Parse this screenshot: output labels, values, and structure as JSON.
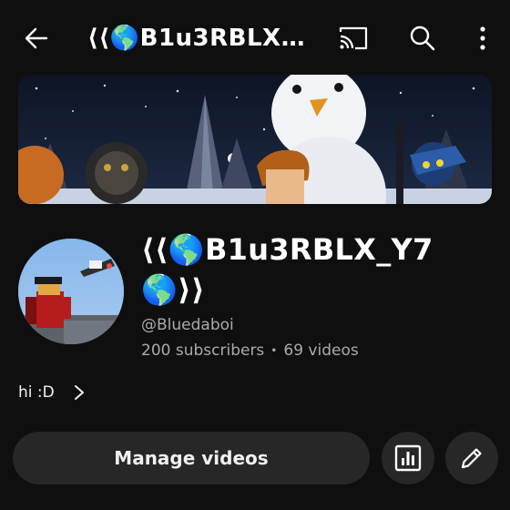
{
  "header": {
    "title": "⟨⟨🌎B1u3RBLX_Y7🌎⟩⟩",
    "icons": {
      "back": "arrow-back-icon",
      "cast": "cast-icon",
      "search": "search-icon",
      "more": "more-vert-icon"
    }
  },
  "channel": {
    "name": "⟨⟨🌎B1u3RBLX_Y7🌎⟩⟩",
    "handle": "@Bluedaboi",
    "subscribers": "200 subscribers",
    "videos": "69 videos",
    "separator": "•",
    "description": "hi :D"
  },
  "actions": {
    "manage_videos_label": "Manage videos",
    "icons": {
      "analytics": "analytics-icon",
      "edit": "edit-pencil-icon",
      "description": "chevron-right-icon"
    }
  },
  "colors": {
    "background": "#0f0f0f",
    "button": "#272727",
    "secondary_text": "#aaaaaa"
  }
}
